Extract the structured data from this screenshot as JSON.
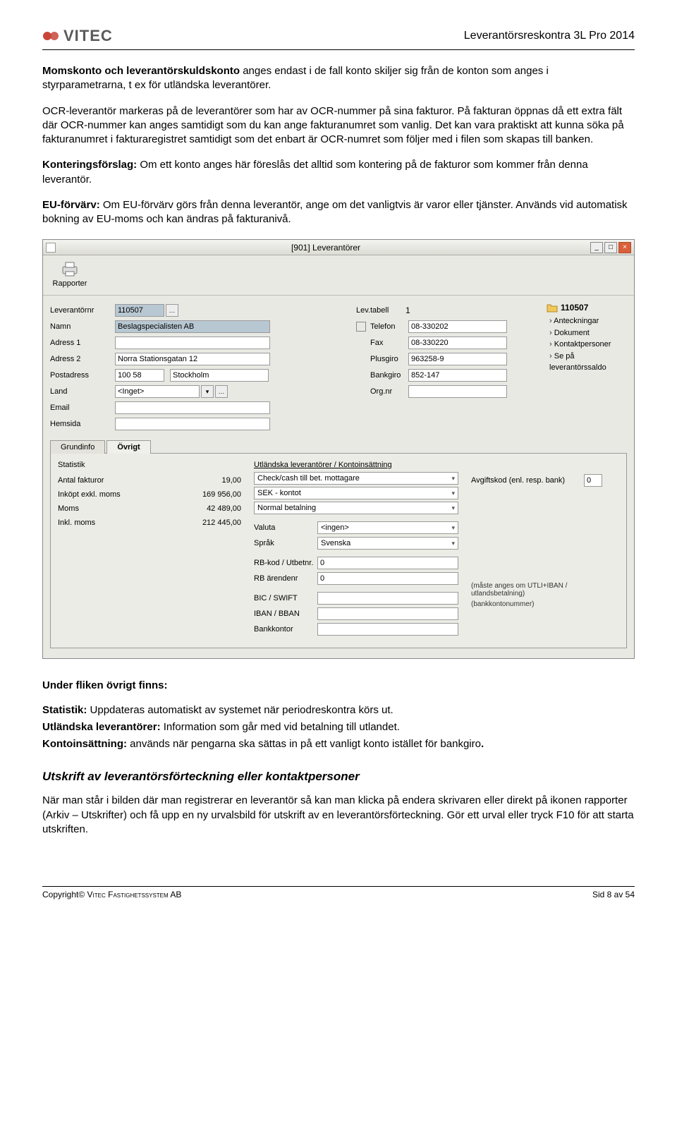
{
  "header": {
    "logo_text": "VITEC",
    "doc_title": "Leverantörsreskontra 3L Pro 2014"
  },
  "prose": {
    "p1a": "Momskonto och leverantörskuldskonto",
    "p1b": " anges endast i de fall konto skiljer sig från de konton som anges i styrparametrarna, t ex för utländska leverantörer.",
    "p2": "OCR-leverantör markeras på de leverantörer som har av OCR-nummer på sina fakturor. På fakturan öppnas då ett extra fält där OCR-nummer kan anges samtidigt som du kan ange fakturanumret som vanlig. Det kan vara praktiskt att kunna söka på fakturanumret i fakturaregistret samtidigt som det enbart är OCR-numret som följer med i filen som skapas till banken.",
    "p3a": "Konteringsförslag:",
    "p3b": " Om ett konto anges här föreslås det alltid som kontering på de fakturor som kommer från denna leverantör.",
    "p4a": "EU-förvärv:",
    "p4b": " Om EU-förvärv görs från denna leverantör, ange om det vanligtvis är varor eller tjänster. Används vid automatisk bokning av EU-moms och kan ändras på fakturanivå."
  },
  "window": {
    "title": "[901]  Leverantörer",
    "report_btn": "Rapporter",
    "min": "_",
    "max": "□",
    "close": "×"
  },
  "form": {
    "leverantornr_label": "Leverantörnr",
    "leverantornr_value": "110507",
    "namn_label": "Namn",
    "namn_value": "Beslagspecialisten AB",
    "adress1_label": "Adress 1",
    "adress1_value": "",
    "adress2_label": "Adress 2",
    "adress2_value": "Norra Stationsgatan 12",
    "postadress_label": "Postadress",
    "post_zip": "100 58",
    "post_city": "Stockholm",
    "land_label": "Land",
    "land_value": "<Inget>",
    "email_label": "Email",
    "hemsida_label": "Hemsida",
    "levtabell_label": "Lev.tabell",
    "levtabell_value": "1",
    "telefon_label": "Telefon",
    "telefon_value": "08-330202",
    "fax_label": "Fax",
    "fax_value": "08-330220",
    "plusgiro_label": "Plusgiro",
    "plusgiro_value": "963258-9",
    "bankgiro_label": "Bankgiro",
    "bankgiro_value": "852-147",
    "orgnr_label": "Org.nr",
    "folder": "110507",
    "side_anteckningar": "Anteckningar",
    "side_dokument": "Dokument",
    "side_kontakt": "Kontaktpersoner",
    "side_saldo": "Se på leverantörssaldo"
  },
  "tabs": {
    "grundinfo": "Grundinfo",
    "ovrigt": "Övrigt"
  },
  "ovrigt": {
    "statistik_title": "Statistik",
    "antal_label": "Antal fakturor",
    "antal_value": "19,00",
    "inkopt_label": "Inköpt exkl. moms",
    "inkopt_value": "169 956,00",
    "moms_label": "Moms",
    "moms_value": "42 489,00",
    "inkl_label": "Inkl. moms",
    "inkl_value": "212 445,00",
    "utl_title": "Utländska leverantörer / Kontoinsättning",
    "sel1": "Check/cash till bet. mottagare",
    "sel2": "SEK - kontot",
    "sel3": "Normal betalning",
    "valuta_label": "Valuta",
    "valuta_value": "<ingen>",
    "sprak_label": "Språk",
    "sprak_value": "Svenska",
    "rbkod_label": "RB-kod / Utbetnr.",
    "rbkod_value": "0",
    "rbarende_label": "RB ärendenr",
    "rbarende_value": "0",
    "bic_label": "BIC / SWIFT",
    "bic_hint": "(måste anges om UTLI+IBAN / utlandsbetalning)",
    "iban_label": "IBAN / BBAN",
    "iban_hint": "(bankkontonummer)",
    "bankkontor_label": "Bankkontor",
    "avgift_label": "Avgiftskod (enl. resp. bank)",
    "avgift_value": "0"
  },
  "lower": {
    "heading1": "Under fliken övrigt finns:",
    "stat_a": "Statistik:",
    "stat_b": " Uppdateras automatiskt av systemet när periodreskontra körs ut.",
    "utl_a": "Utländska leverantörer:",
    "utl_b": " Information som går med vid betalning till utlandet.",
    "konto_a": "Kontoinsättning:",
    "konto_b": " används när pengarna ska sättas in på ett vanligt konto istället för bankgiro",
    "period": ".",
    "heading2": "Utskrift av leverantörsförteckning eller kontaktpersoner",
    "p_last": "När man står i bilden där man registrerar en leverantör så kan man klicka på endera skrivaren eller direkt på ikonen rapporter (Arkiv – Utskrifter) och få upp en ny urvalsbild för utskrift av en leverantörsförteckning. Gör ett urval eller tryck F10 för att starta utskriften."
  },
  "footer": {
    "copyright_a": "Copyright© ",
    "copyright_b": "Vitec Fastighetssystem AB",
    "page": "Sid 8 av 54"
  }
}
